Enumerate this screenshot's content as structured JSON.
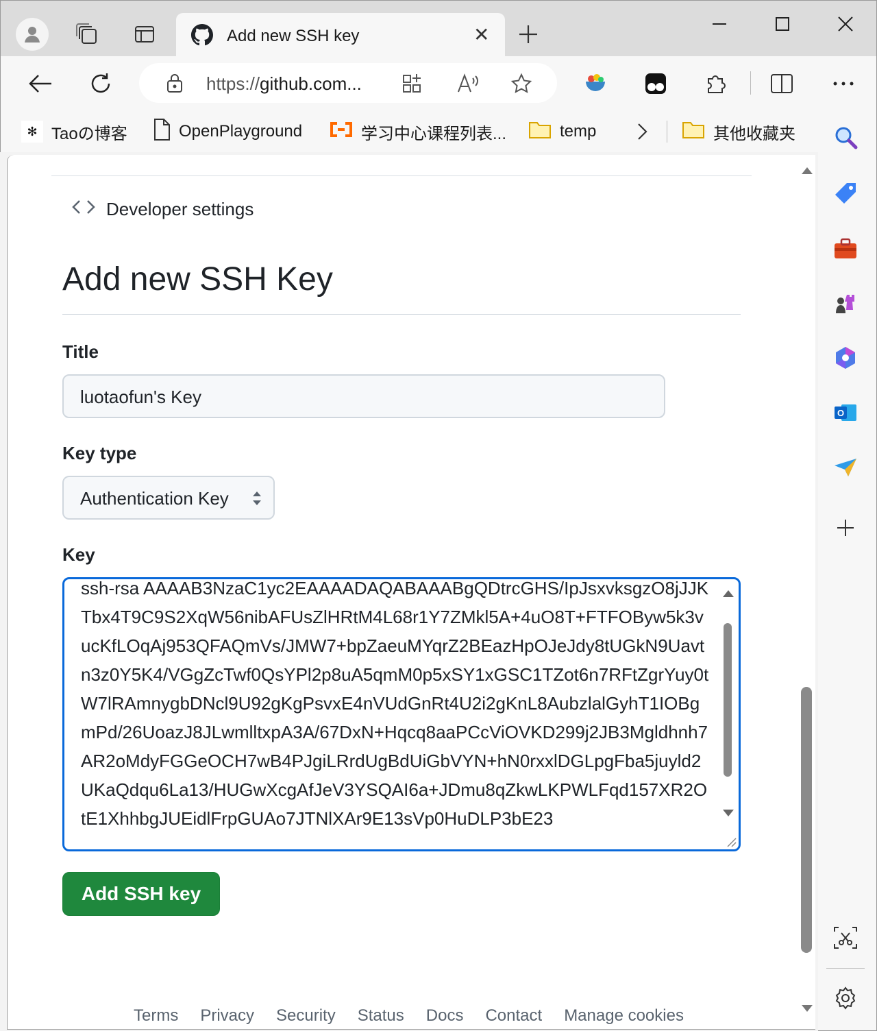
{
  "browser": {
    "tab": {
      "title": "Add new SSH key",
      "favicon": "github-icon"
    },
    "address": {
      "scheme": "https://",
      "host": "github.com",
      "ellipsis": "..."
    },
    "bookmarks": [
      {
        "label": "Taoの博客",
        "icon": "butterfly-icon"
      },
      {
        "label": "OpenPlayground",
        "icon": "page-icon"
      },
      {
        "label": "学习中心课程列表...",
        "icon": "aliyun-icon"
      },
      {
        "label": "temp",
        "icon": "folder-icon"
      },
      {
        "label": "其他收藏夹",
        "icon": "folder-icon"
      }
    ]
  },
  "page": {
    "breadcrumb": "Developer settings",
    "heading": "Add new SSH Key",
    "title_label": "Title",
    "title_value": "luotaofun's Key",
    "keytype_label": "Key type",
    "keytype_value": "Authentication Key",
    "key_label": "Key",
    "key_value": "ssh-rsa AAAAB3NzaC1yc2EAAAADAQABAAABgQDtrcGHS/IpJsxvksgzO8jJJKTbx4T9C9S2XqW56nibAFUsZlHRtM4L68r1Y7ZMkl5A+4uO8T+FTFOByw5k3vucKfLOqAj953QFAQmVs/JMW7+bpZaeuMYqrZ2BEazHpOJeJdy8tUGkN9Uavtn3z0Y5K4/VGgZcTwf0QsYPl2p8uA5qmM0p5xSY1xGSC1TZot6n7RFtZgrYuy0tW7lRAmnygbDNcl9U92gKgPsvxE4nVUdGnRt4U2i2gKnL8AubzlalGyhT1IOBgmPd/26UoazJ8JLwmlltxpA3A/67DxN+Hqcq8aaPCcViOVKD299j2JB3Mgldhnh7AR2oMdyFGGeOCH7wB4PJgiLRrdUgBdUiGbVYN+hN0rxxlDGLpgFba5juyld2UKaQdqu6La13/HUGwXcgAfJeV3YSQAI6a+JDmu8qZkwLKPWLFqd157XR2OtE1XhhbgJUEidlFrpGUAo7JTNlXAr9E13sVp0HuDLP3bE23",
    "add_button": "Add SSH key",
    "footer": [
      "Terms",
      "Privacy",
      "Security",
      "Status",
      "Docs",
      "Contact",
      "Manage cookies"
    ]
  }
}
